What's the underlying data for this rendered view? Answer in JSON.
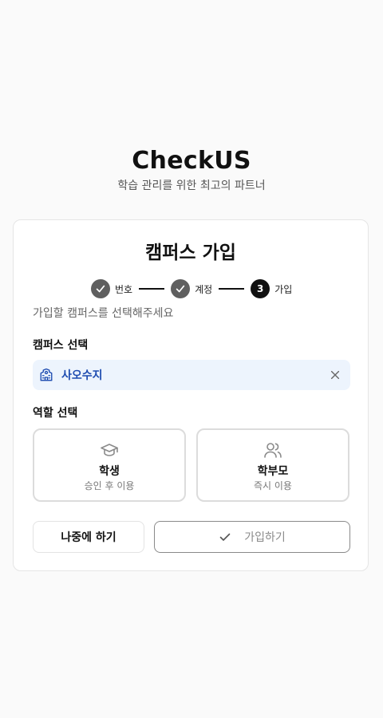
{
  "brand": {
    "title": "CheckUS",
    "tagline": "학습 관리를 위한 최고의 파트너"
  },
  "card": {
    "title": "캠퍼스 가입",
    "stepper": {
      "steps": [
        {
          "label": "번호",
          "status": "done",
          "icon": "check-icon"
        },
        {
          "label": "계정",
          "status": "done",
          "icon": "check-icon"
        },
        {
          "label": "가입",
          "status": "current",
          "number": "3"
        }
      ]
    },
    "instruction": "가입할 캠퍼스를 선택해주세요",
    "campus": {
      "label": "캠퍼스 선택",
      "icon": "school-building-icon",
      "selected": "사오수지",
      "clear_icon": "close-icon"
    },
    "roles": {
      "label": "역할 선택",
      "options": [
        {
          "icon": "graduation-cap-icon",
          "title": "학생",
          "subtitle": "승인 후 이용"
        },
        {
          "icon": "users-icon",
          "title": "학부모",
          "subtitle": "즉시 이용"
        }
      ]
    },
    "buttons": {
      "later": "나중에 하기",
      "join": "가입하기",
      "join_icon": "check-icon"
    }
  },
  "colors": {
    "background": "#fafafa",
    "step_done": "#5f5f5f",
    "step_current": "#111111",
    "campus_field_bg": "#edf4fd",
    "campus_text": "#1d4bb0",
    "join_button_disabled": "#8a8a8a"
  }
}
